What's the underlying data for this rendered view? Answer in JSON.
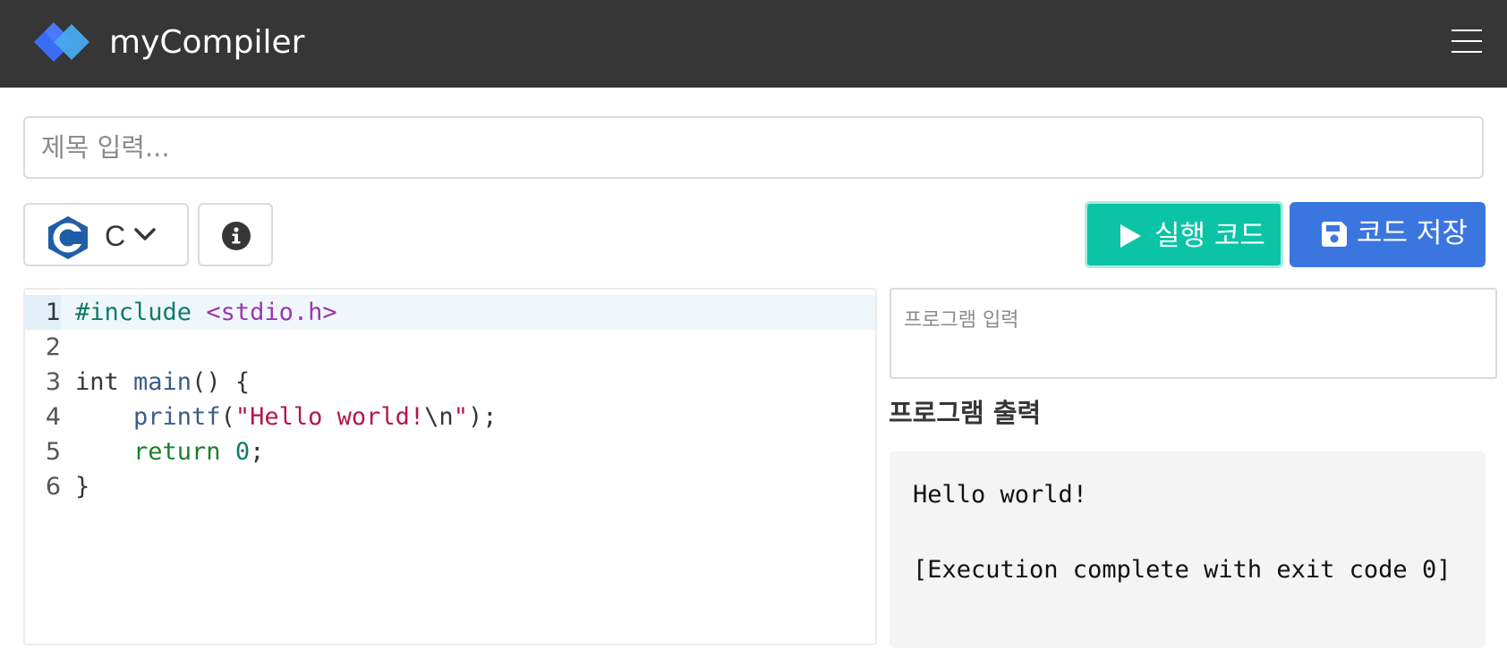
{
  "app": {
    "brand": "myCompiler"
  },
  "header": {
    "logo_icon": "mycompiler-logo-icon",
    "menu_icon": "hamburger-menu-icon"
  },
  "title_field": {
    "placeholder": "제목 입력...",
    "value": ""
  },
  "toolbar": {
    "language": {
      "icon": "c-language-icon",
      "label": "C"
    },
    "info_icon": "info-icon",
    "run_label": "실행 코드",
    "run_icon": "play-icon",
    "save_label": "코드 저장",
    "save_icon": "floppy-disk-icon",
    "colors": {
      "run": "#0bc4a6",
      "save": "#3b76e0",
      "navbar": "#363636"
    }
  },
  "editor": {
    "lines": [
      {
        "num": "1",
        "tokens": [
          {
            "t": "#include ",
            "c": "pre"
          },
          {
            "t": "<stdio.h>",
            "c": "inc"
          }
        ]
      },
      {
        "num": "2",
        "tokens": []
      },
      {
        "num": "3",
        "tokens": [
          {
            "t": "int ",
            "c": "plain"
          },
          {
            "t": "main",
            "c": "fn"
          },
          {
            "t": "() {",
            "c": "plain"
          }
        ]
      },
      {
        "num": "4",
        "tokens": [
          {
            "t": "    ",
            "c": "plain"
          },
          {
            "t": "printf",
            "c": "fn"
          },
          {
            "t": "(",
            "c": "plain"
          },
          {
            "t": "\"Hello world!",
            "c": "str"
          },
          {
            "t": "\\n",
            "c": "plain"
          },
          {
            "t": "\"",
            "c": "str"
          },
          {
            "t": ");",
            "c": "plain"
          }
        ]
      },
      {
        "num": "5",
        "tokens": [
          {
            "t": "    ",
            "c": "plain"
          },
          {
            "t": "return ",
            "c": "ret"
          },
          {
            "t": "0",
            "c": "num"
          },
          {
            "t": ";",
            "c": "plain"
          }
        ]
      },
      {
        "num": "6",
        "tokens": [
          {
            "t": "}",
            "c": "plain"
          }
        ]
      }
    ]
  },
  "program_input": {
    "placeholder": "프로그램 입력",
    "value": ""
  },
  "program_output": {
    "heading": "프로그램 출력",
    "text": "Hello world!\n\n[Execution complete with exit code 0]"
  }
}
